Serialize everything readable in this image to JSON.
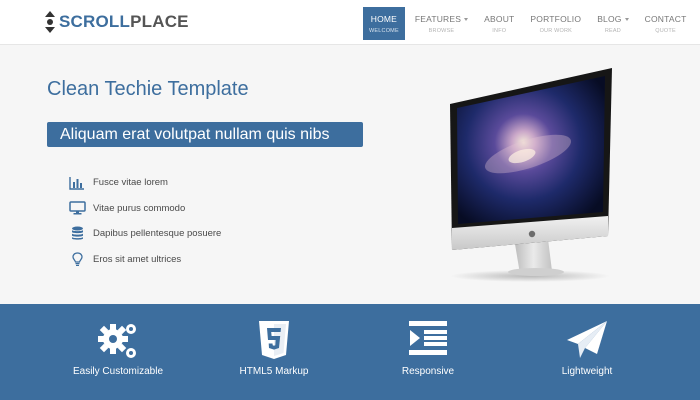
{
  "brand": {
    "part1": "SCROLL",
    "part2": "PLACE"
  },
  "nav": {
    "items": [
      {
        "label": "HOME",
        "sub": "WELCOME",
        "active": true,
        "caret": false
      },
      {
        "label": "FEATURES",
        "sub": "BROWSE",
        "active": false,
        "caret": true
      },
      {
        "label": "ABOUT",
        "sub": "INFO",
        "active": false,
        "caret": false
      },
      {
        "label": "PORTFOLIO",
        "sub": "OUR WORK",
        "active": false,
        "caret": false
      },
      {
        "label": "BLOG",
        "sub": "READ",
        "active": false,
        "caret": true
      },
      {
        "label": "CONTACT",
        "sub": "QUOTE",
        "active": false,
        "caret": false
      }
    ]
  },
  "hero": {
    "title": "Clean Techie Template",
    "banner": "Aliquam erat volutpat nullam quis nibs",
    "features": [
      {
        "icon": "bar-chart-icon",
        "text": "Fusce vitae lorem"
      },
      {
        "icon": "monitor-icon",
        "text": "Vitae purus commodo"
      },
      {
        "icon": "database-icon",
        "text": "Dapibus pellentesque posuere"
      },
      {
        "icon": "lightbulb-icon",
        "text": "Eros sit amet ultrices"
      }
    ]
  },
  "band": {
    "items": [
      {
        "icon": "gears-icon",
        "label": "Easily Customizable"
      },
      {
        "icon": "html5-icon",
        "label": "HTML5 Markup"
      },
      {
        "icon": "responsive-icon",
        "label": "Responsive"
      },
      {
        "icon": "paper-plane-icon",
        "label": "Lightweight"
      }
    ]
  },
  "colors": {
    "accent": "#3d6e9e",
    "background": "#f6f6f6",
    "text": "#4a4a4a"
  }
}
